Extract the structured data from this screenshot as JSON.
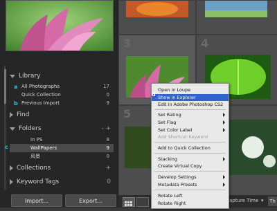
{
  "left_panel": {
    "sections": {
      "library": "Library",
      "find": "Find",
      "folders": "Folders",
      "collections": "Collections",
      "keyword_tags": "Keyword Tags"
    },
    "library_items": [
      {
        "label": "All Photographs",
        "count": "17",
        "marker": "a"
      },
      {
        "label": "Quick Collection",
        "count": "0"
      },
      {
        "label": "Previous Import",
        "count": "9",
        "marker": "b"
      }
    ],
    "folders": [
      {
        "label": "In PS",
        "count": "8"
      },
      {
        "label": "WallPapers",
        "count": "9"
      },
      {
        "label": "风景",
        "count": "0"
      }
    ],
    "folders_marker": "c",
    "plus": "+",
    "minus": "-",
    "keyword_tags_count": "0",
    "buttons": {
      "import": "Import...",
      "export": "Export..."
    }
  },
  "grid": {
    "cell_numbers": [
      "3",
      "4",
      "5"
    ]
  },
  "toolbar": {
    "sort_label": "apture Time",
    "sort_arrow": "▾",
    "right_label": "Th"
  },
  "context_menu": {
    "marker": "d",
    "items": [
      {
        "label": "Open in Loupe"
      },
      {
        "label": "Show in Explorer",
        "highlighted": true
      },
      {
        "label": "Edit in Adobe Photoshop CS2"
      },
      {
        "label": "Set Rating",
        "submenu": true
      },
      {
        "label": "Set Flag",
        "submenu": true
      },
      {
        "label": "Set Color Label",
        "submenu": true
      },
      {
        "label": "Add Shortcut Keyword",
        "disabled": true
      },
      {
        "label": "Add to Quick Collection"
      },
      {
        "label": "Stacking",
        "submenu": true
      },
      {
        "label": "Create Virtual Copy"
      },
      {
        "label": "Develop Settings",
        "submenu": true
      },
      {
        "label": "Metadata Presets",
        "submenu": true
      },
      {
        "label": "Rotate Left"
      },
      {
        "label": "Rotate Right"
      }
    ]
  },
  "colors": {
    "marker": "#22c6e0",
    "menu_highlight": "#3062d0",
    "selected_folder": "#4a4a4a"
  }
}
